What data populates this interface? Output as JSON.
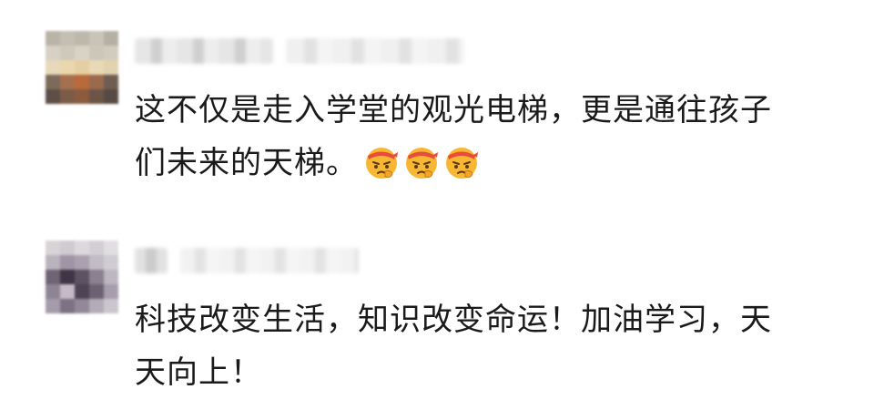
{
  "comments": [
    {
      "text_line1": "这不仅是走入学堂的观光电梯，更是通往孩子",
      "text_line2": "们未来的天梯。",
      "emoji_count": 3,
      "emoji_icon": "determined-face-headband-icon"
    },
    {
      "text_line1": "科技改变生活，知识改变命运！加油学习，天",
      "text_line2": "天向上！"
    }
  ],
  "colors": {
    "text": "#1a1a1a",
    "background": "#ffffff",
    "emoji_face": "#f7b733",
    "emoji_band": "#e94b3c"
  }
}
